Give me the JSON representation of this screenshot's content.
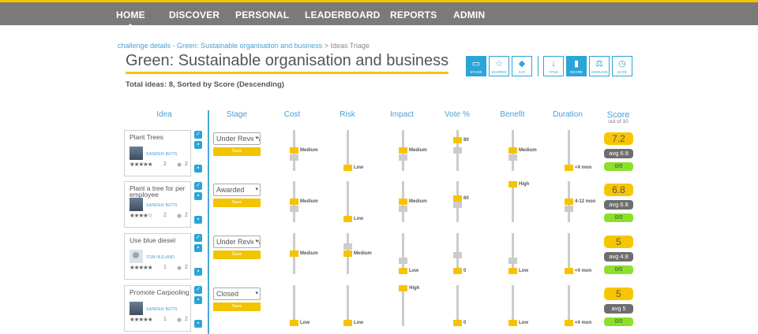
{
  "nav": [
    {
      "label": "HOME",
      "active": true
    },
    {
      "label": "DISCOVER"
    },
    {
      "label": "PERSONAL"
    },
    {
      "label": "LEADERBOARD"
    },
    {
      "label": "REPORTS"
    },
    {
      "label": "ADMIN"
    }
  ],
  "breadcrumb": {
    "link": "challenge details - Green: Sustainable organisation and business",
    "current": "> Ideas Triage"
  },
  "title": "Green: Sustainable organisation and business",
  "subtitle": "Total ideas: 8, Sorted by Score (Descending)",
  "toolbar": [
    {
      "label": "STAGE",
      "icon": "battery-icon",
      "glyph": "▭",
      "active": true
    },
    {
      "label": "SCORED",
      "icon": "star-check-icon",
      "glyph": "☆",
      "active": false
    },
    {
      "label": "CAT",
      "icon": "tag-icon",
      "glyph": "◆",
      "active": false
    },
    {
      "label": "TITLE",
      "icon": "sort-alpha-icon",
      "glyph": "↓",
      "active": false
    },
    {
      "label": "SCORE",
      "icon": "bar-chart-icon",
      "glyph": "▮",
      "active": true
    },
    {
      "label": "AVERAGE",
      "icon": "scales-icon",
      "glyph": "⚖",
      "active": false
    },
    {
      "label": "DATE",
      "icon": "clock-icon",
      "glyph": "◷",
      "active": false
    }
  ],
  "columns": {
    "idea": "Idea",
    "stage": "Stage",
    "cost": "Cost",
    "risk": "Risk",
    "impact": "Impact",
    "vote": "Vote %",
    "benefit": "Benefit",
    "duration": "Duration",
    "score": "Score",
    "score_sub": "out of 10"
  },
  "save_label": "Save",
  "colors": {
    "accent": "#f2c400",
    "blue": "#2aa5d8",
    "green": "#8be02a",
    "nav": "#7a7a7a"
  },
  "ideas": [
    {
      "title": "Plant Trees",
      "author": "SANDER BOTS",
      "avatar": "photo",
      "stars": 5,
      "rating_count": "2",
      "views": "2",
      "stage": "Under Review",
      "metrics": {
        "cost": {
          "label": "Medium",
          "level": 0.5,
          "avg": 0.3
        },
        "risk": {
          "label": "Low",
          "level": 0.0
        },
        "impact": {
          "label": "Medium",
          "level": 0.5,
          "avg": 0.3
        },
        "vote": {
          "label": "80",
          "level": 0.8,
          "avg": 0.5
        },
        "benefit": {
          "label": "Medium",
          "level": 0.5,
          "avg": 0.3
        },
        "duration": {
          "label": "<4 mon",
          "level": 0.0
        }
      },
      "score": "7.2",
      "avg": "avg 6.9",
      "votes": "0/0"
    },
    {
      "title": "Plant a tree for per employee",
      "author": "SANDER BOTS",
      "avatar": "photo",
      "stars": 4,
      "rating_count": "2",
      "views": "2",
      "stage": "Awarded",
      "metrics": {
        "cost": {
          "label": "Medium",
          "level": 0.5,
          "avg": 0.3
        },
        "risk": {
          "label": "Low",
          "level": 0.0
        },
        "impact": {
          "label": "Medium",
          "level": 0.5,
          "avg": 0.3
        },
        "vote": {
          "label": "60",
          "level": 0.6,
          "avg": 0.4
        },
        "benefit": {
          "label": "High",
          "level": 1.0
        },
        "duration": {
          "label": "4-12 mon",
          "level": 0.5,
          "avg": 0.3
        }
      },
      "score": "6.8",
      "avg": "avg 6.8",
      "votes": "0/0"
    },
    {
      "title": "Use blue diesel",
      "author": "TON NIJLAND",
      "avatar": "generic",
      "stars": 5,
      "rating_count": "1",
      "views": "2",
      "stage": "Under Review",
      "metrics": {
        "cost": {
          "label": "Medium",
          "level": 0.5
        },
        "risk": {
          "label": "Medium",
          "level": 0.5,
          "avg": 0.7
        },
        "impact": {
          "label": "Low",
          "level": 0.0,
          "avg": 0.3
        },
        "vote": {
          "label": "0",
          "level": 0.0,
          "avg": 0.45
        },
        "benefit": {
          "label": "Low",
          "level": 0.0,
          "avg": 0.3
        },
        "duration": {
          "label": "<4 mon",
          "level": 0.0
        }
      },
      "score": "5",
      "avg": "avg 4.8",
      "votes": "0/0"
    },
    {
      "title": "Promote Carpooling",
      "author": "SANDER BOTS",
      "avatar": "photo",
      "stars": 5,
      "rating_count": "1",
      "views": "2",
      "stage": "Closed",
      "metrics": {
        "cost": {
          "label": "Low",
          "level": 0.0
        },
        "risk": {
          "label": "Low",
          "level": 0.0
        },
        "impact": {
          "label": "High",
          "level": 1.0
        },
        "vote": {
          "label": "0",
          "level": 0.0
        },
        "benefit": {
          "label": "Low",
          "level": 0.0
        },
        "duration": {
          "label": "<4 mon",
          "level": 0.0
        }
      },
      "score": "5",
      "avg": "avg 5",
      "votes": "0/0"
    }
  ]
}
